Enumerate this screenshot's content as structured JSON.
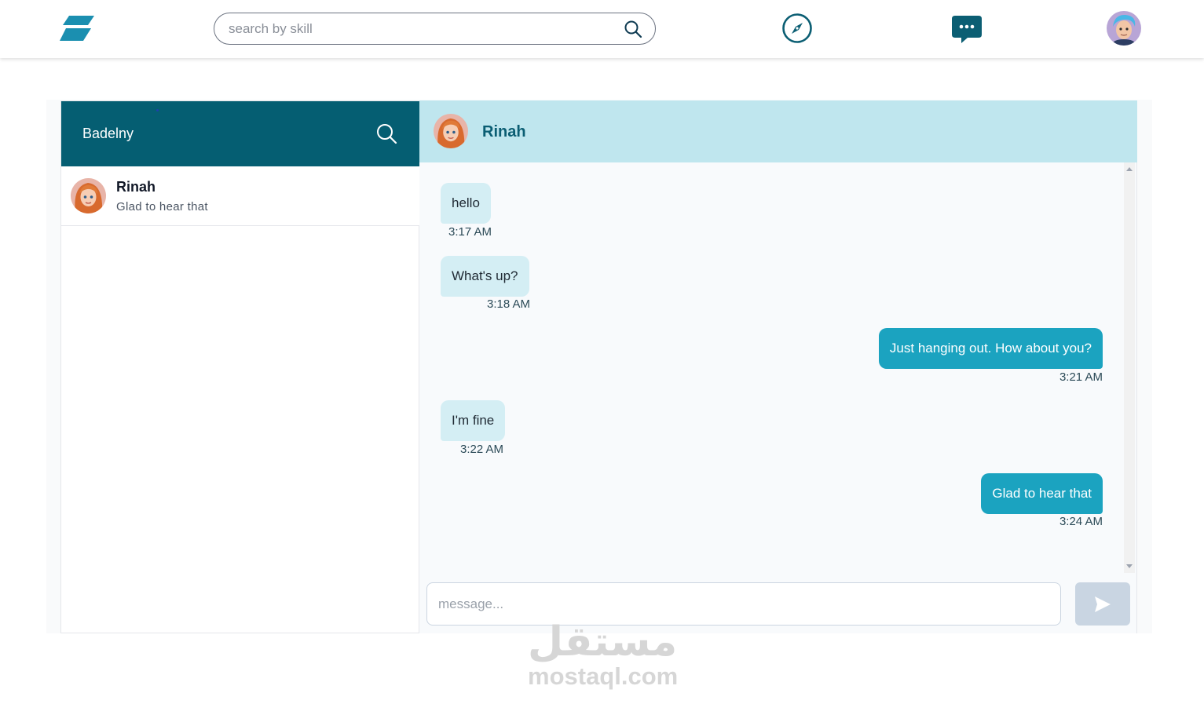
{
  "header": {
    "search_placeholder": "search by skill",
    "icons": [
      "logo-icon",
      "search-icon",
      "compass-icon",
      "chat-icon",
      "user-avatar"
    ]
  },
  "sidebar": {
    "brand": "Badelny",
    "conversations": [
      {
        "name": "Rinah",
        "preview": "Glad to hear that"
      }
    ]
  },
  "chat": {
    "contact_name": "Rinah",
    "messages": [
      {
        "direction": "in",
        "text": "hello",
        "time": "3:17 AM"
      },
      {
        "direction": "in",
        "text": "What's up?",
        "time": "3:18 AM"
      },
      {
        "direction": "out",
        "text": "Just hanging out. How about you?",
        "time": "3:21 AM"
      },
      {
        "direction": "in",
        "text": "I'm fine",
        "time": "3:22 AM"
      },
      {
        "direction": "out",
        "text": "Glad to hear that",
        "time": "3:24 AM"
      }
    ],
    "composer_placeholder": "message...",
    "colors": {
      "incoming": "#d4eef4",
      "outgoing": "#1ba3c0",
      "header": "#bfe6ee",
      "sidebar_header": "#055e72"
    }
  },
  "watermark": {
    "arabic": "مستقل",
    "latin": "mostaql.com"
  }
}
